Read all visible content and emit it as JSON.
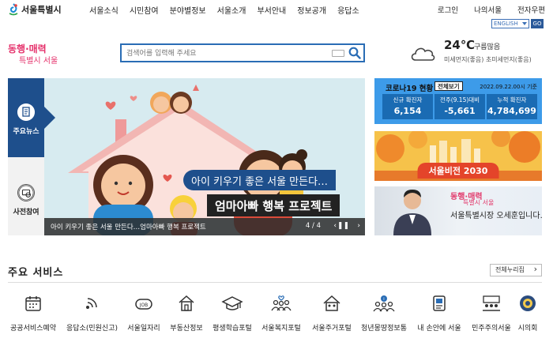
{
  "header": {
    "logo_text": "서울특별시",
    "nav": [
      "서울소식",
      "시민참여",
      "분야별정보",
      "서울소개",
      "부서안내",
      "정보공개",
      "응답소"
    ],
    "util": [
      "로그인",
      "나의서울",
      "전자우편"
    ],
    "lang_select": "ENGLISH",
    "lang_go": "GO",
    "slogan_line1": "동행·매력",
    "slogan_line2": "특별시 서울"
  },
  "search": {
    "placeholder": "검색어를 입력해 주세요"
  },
  "weather": {
    "temperature": "24℃",
    "status": "구름많음",
    "dust": "미세먼지(좋음) 초미세먼지(좋음)"
  },
  "hero": {
    "tabs": [
      {
        "label": "주요뉴스",
        "icon": "news-icon"
      },
      {
        "label": "사전참여",
        "icon": "participation-icon"
      }
    ],
    "title_line1": "아이 키우기 좋은 서울 만든다…",
    "title_line2": "엄마아빠 행복 프로젝트",
    "caption": "아이 키우기 좋은 서울 만든다…엄마아빠 행복 프로젝트",
    "counter": "4 / 4"
  },
  "covid": {
    "title": "코로나19 현황",
    "more": "전체보기",
    "date": "2022.09.22.00시 기준",
    "stats": [
      {
        "label": "신규 확진자",
        "value": "6,154"
      },
      {
        "label": "전주(9.15)대비",
        "value": "-5,661"
      },
      {
        "label": "누적 확진자",
        "value": "4,784,699"
      }
    ]
  },
  "banners": {
    "vision": "서울비전 2030",
    "mayor_slogan_line1": "동행·매력",
    "mayor_slogan_line2": "특별시 서울",
    "mayor_text": "서울특별시장 오세훈입니다."
  },
  "services": {
    "title": "주요 서비스",
    "all_button": "전체누리집",
    "items": [
      {
        "label": "공공서비스예약",
        "icon": "calendar-icon"
      },
      {
        "label": "응답소(민원신고)",
        "icon": "signal-icon"
      },
      {
        "label": "서울일자리",
        "icon": "job-icon"
      },
      {
        "label": "부동산정보",
        "icon": "house-icon"
      },
      {
        "label": "평생학습포털",
        "icon": "graduation-cap-icon"
      },
      {
        "label": "서울복지포털",
        "icon": "people-heart-icon"
      },
      {
        "label": "서울주거포털",
        "icon": "home-group-icon"
      },
      {
        "label": "청년몽땅정보통",
        "icon": "youth-icon"
      },
      {
        "label": "내 손안에 서울",
        "icon": "mobile-news-icon"
      },
      {
        "label": "민주주의서울",
        "icon": "assembly-icon"
      },
      {
        "label": "시의회",
        "icon": "council-icon"
      }
    ]
  }
}
